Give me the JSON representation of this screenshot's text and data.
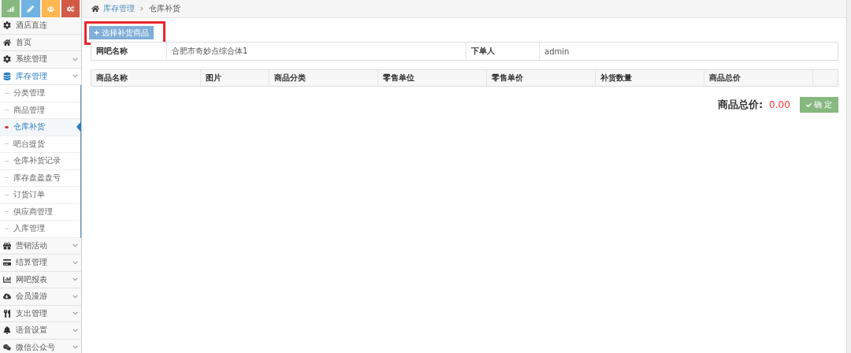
{
  "shortcuts": [
    {
      "color": "#87b87f"
    },
    {
      "color": "#6fb3e0"
    },
    {
      "color": "#ffb752"
    },
    {
      "color": "#d15b47"
    }
  ],
  "menu": [
    {
      "label": "酒店直连",
      "expandable": false,
      "expanded": false
    },
    {
      "label": "首页",
      "expandable": false,
      "expanded": false
    },
    {
      "label": "系统管理",
      "expandable": true,
      "expanded": false
    },
    {
      "label": "库存管理",
      "expandable": true,
      "expanded": true,
      "children": [
        {
          "label": "分类管理",
          "selected": false
        },
        {
          "label": "商品管理",
          "selected": false
        },
        {
          "label": "仓库补货",
          "selected": true
        },
        {
          "label": "吧台提货",
          "selected": false
        },
        {
          "label": "仓库补货记录",
          "selected": false
        },
        {
          "label": "库存盘盈盘亏",
          "selected": false
        },
        {
          "label": "订货订单",
          "selected": false
        },
        {
          "label": "供应商管理",
          "selected": false
        },
        {
          "label": "入库管理",
          "selected": false
        }
      ]
    },
    {
      "label": "营销活动",
      "expandable": true,
      "expanded": false
    },
    {
      "label": "结算管理",
      "expandable": true,
      "expanded": false
    },
    {
      "label": "网吧报表",
      "expandable": true,
      "expanded": false
    },
    {
      "label": "会员漫游",
      "expandable": true,
      "expanded": false
    },
    {
      "label": "支出管理",
      "expandable": true,
      "expanded": false
    },
    {
      "label": "语音设置",
      "expandable": true,
      "expanded": false
    },
    {
      "label": "微信公众号",
      "expandable": true,
      "expanded": false
    }
  ],
  "breadcrumb": [
    "库存管理",
    "仓库补货"
  ],
  "add_button": {
    "label": "选择补货商品",
    "highlighted": true
  },
  "info": [
    {
      "label": "网吧名称",
      "value": "合肥市奇妙点综合体1"
    },
    {
      "label": "下单人",
      "value": "admin"
    }
  ],
  "table": {
    "columns": [
      "商品名称",
      "图片",
      "商品分类",
      "零售单位",
      "零售单价",
      "补货数量",
      "商品总价",
      ""
    ]
  },
  "total": {
    "label": "商品总价:",
    "value": "0.00"
  },
  "confirm_button": {
    "label": "确 定"
  }
}
